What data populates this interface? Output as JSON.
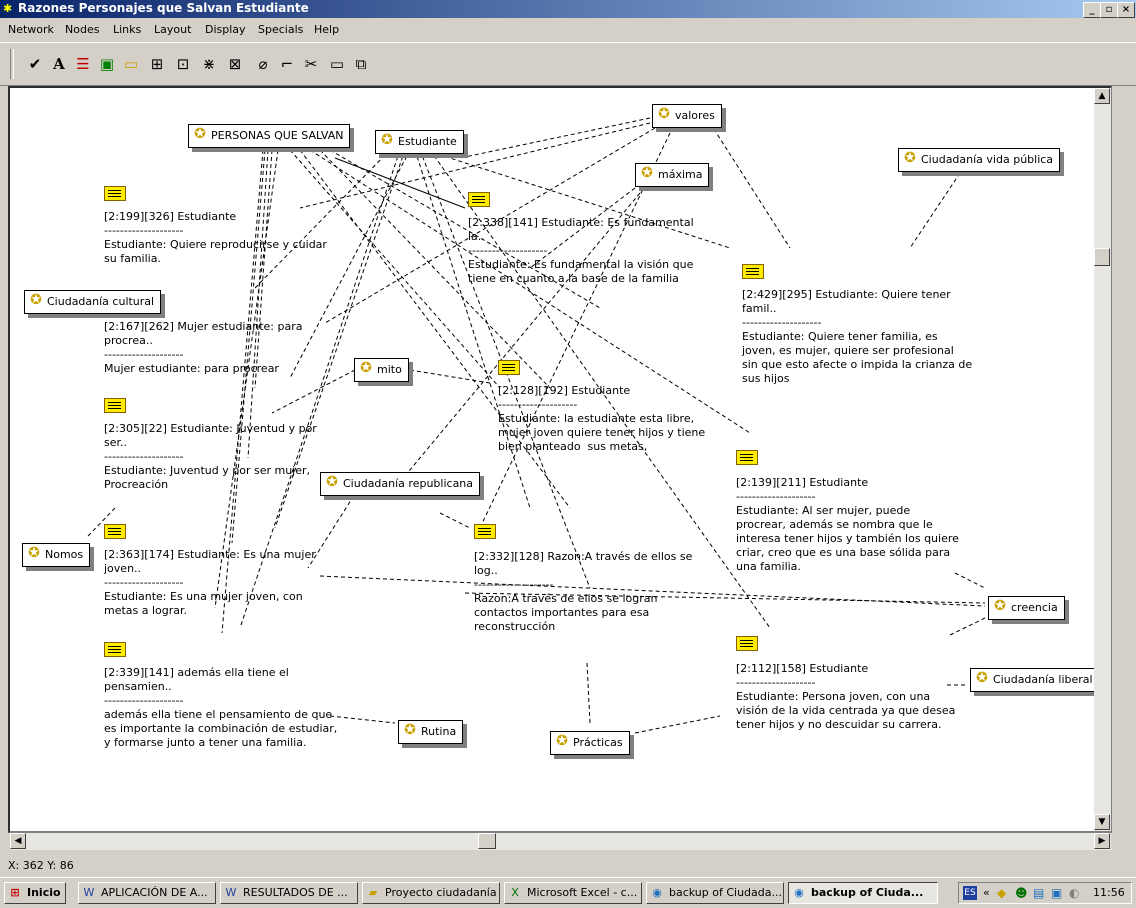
{
  "window": {
    "title": "Razones Personajes que Salvan Estudiante",
    "icon": "network-icon"
  },
  "menu": [
    "Network",
    "Nodes",
    "Links",
    "Layout",
    "Display",
    "Specials",
    "Help"
  ],
  "toolbar": [
    "check-icon",
    "text-icon",
    "color-bars-icon",
    "node-display-icon",
    "rectangle-icon",
    "layout-tree-icon",
    "layout-grid-icon",
    "layout-spread-icon",
    "layout-cluster-icon",
    "eraser-icon",
    "link-connector-icon",
    "cut-icon",
    "preview-icon",
    "copy-network-icon"
  ],
  "codes": {
    "personas": "PERSONAS QUE SALVAN",
    "estudiante": "Estudiante",
    "valores": "valores",
    "maxima": "máxima",
    "vida_publica": "Ciudadanía vida pública",
    "cultural": "Ciudadanía cultural",
    "mito": "mito",
    "republicana": "Ciudadanía republicana",
    "nomos": "Nomos",
    "rutina": "Rutina",
    "practicas": "Prácticas",
    "creencia": "creencia",
    "liberal": "Ciudadanía liberal"
  },
  "memos": {
    "m199": "[2:199][326] Estudiante\n--------------------\nEstudiante: Quiere reproducirse y cuidar\nsu familia.",
    "m167": "[2:167][262] Mujer estudiante: para\nprocrea..\n--------------------\nMujer estudiante: para procrear",
    "m305": "[2:305][22] Estudiante: Juventud y por\nser..\n--------------------\nEstudiante: Juventud y por ser mujer,\nProcreación",
    "m363": "[2:363][174] Estudiante: Es una mujer\njoven..\n--------------------\nEstudiante: Es una mujer joven, con\nmetas a lograr.",
    "m339": "[2:339][141] además ella tiene el\npensamien..\n--------------------\nademás ella tiene el pensamiento de que\nes importante la combinación de estudiar,\ny formarse junto a tener una familia.",
    "m338": "[2:338][141] Estudiante: Es fundamental\nla..\n--------------------\nEstudiante: Es fundamental la visión que\ntiene en cuanto a la base de la familia",
    "m128": "[2:128][192] Estudiante\n--------------------\nEstudiante: la estudiante esta libre,\nmujer joven quiere tener hijos y tiene\nbien planteado  sus metas,",
    "m332": "[2:332][128] Razon:A través de ellos se\nlog..\n--------------------\nRazon:A través de ellos se logran\ncontactos importantes para esa\nreconstrucción",
    "m429": "[2:429][295] Estudiante: Quiere tener\nfamil..\n--------------------\nEstudiante: Quiere tener familia, es\njoven, es mujer, quiere ser profesional\nsin que esto afecte o impida la crianza de\nsus hijos",
    "m139": "[2:139][211] Estudiante\n--------------------\nEstudiante: Al ser mujer, puede\nprocrear, además se nombra que le\ninteresa tener hijos y también los quiere\ncriar, creo que es una base sólida para\nuna familia.",
    "m112": "[2:112][158] Estudiante\n--------------------\nEstudiante: Persona joven, con una\nvisión de la vida centrada ya que desea\ntener hijos y no descuidar su carrera."
  },
  "status": "X: 362 Y: 86",
  "taskbar": {
    "start": "Inicio",
    "tasks": [
      {
        "label": "APLICACIÓN DE A...",
        "icon": "word-icon"
      },
      {
        "label": "RESULTADOS DE ...",
        "icon": "word-icon"
      },
      {
        "label": "Proyecto ciudadanía",
        "icon": "folder-icon"
      },
      {
        "label": "Microsoft Excel - c...",
        "icon": "excel-icon"
      },
      {
        "label": "backup of Ciudada...",
        "icon": "atlasti-icon"
      },
      {
        "label": "backup of Ciuda...",
        "icon": "atlasti-icon"
      }
    ],
    "lang": "ES",
    "clock": "11:56"
  }
}
